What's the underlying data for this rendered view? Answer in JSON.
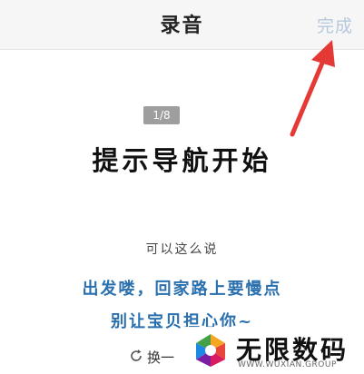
{
  "header": {
    "title": "录音",
    "done_label": "完成"
  },
  "annotation": {
    "arrow_color": "#e53935"
  },
  "progress": {
    "badge": "1/8",
    "current": 1,
    "total": 8
  },
  "prompt": {
    "title": "提示导航开始",
    "hint": "可以这么说",
    "phrase_lines": [
      "出发喽，回家路上要慢点",
      "别让宝贝担心你~"
    ],
    "phrase_color": "#2a6fae"
  },
  "footer": {
    "switch_label": "换一",
    "icon": "refresh-icon"
  },
  "watermark": {
    "name": "无限数码",
    "url": "WWW.WUXIAN.GROUP"
  }
}
